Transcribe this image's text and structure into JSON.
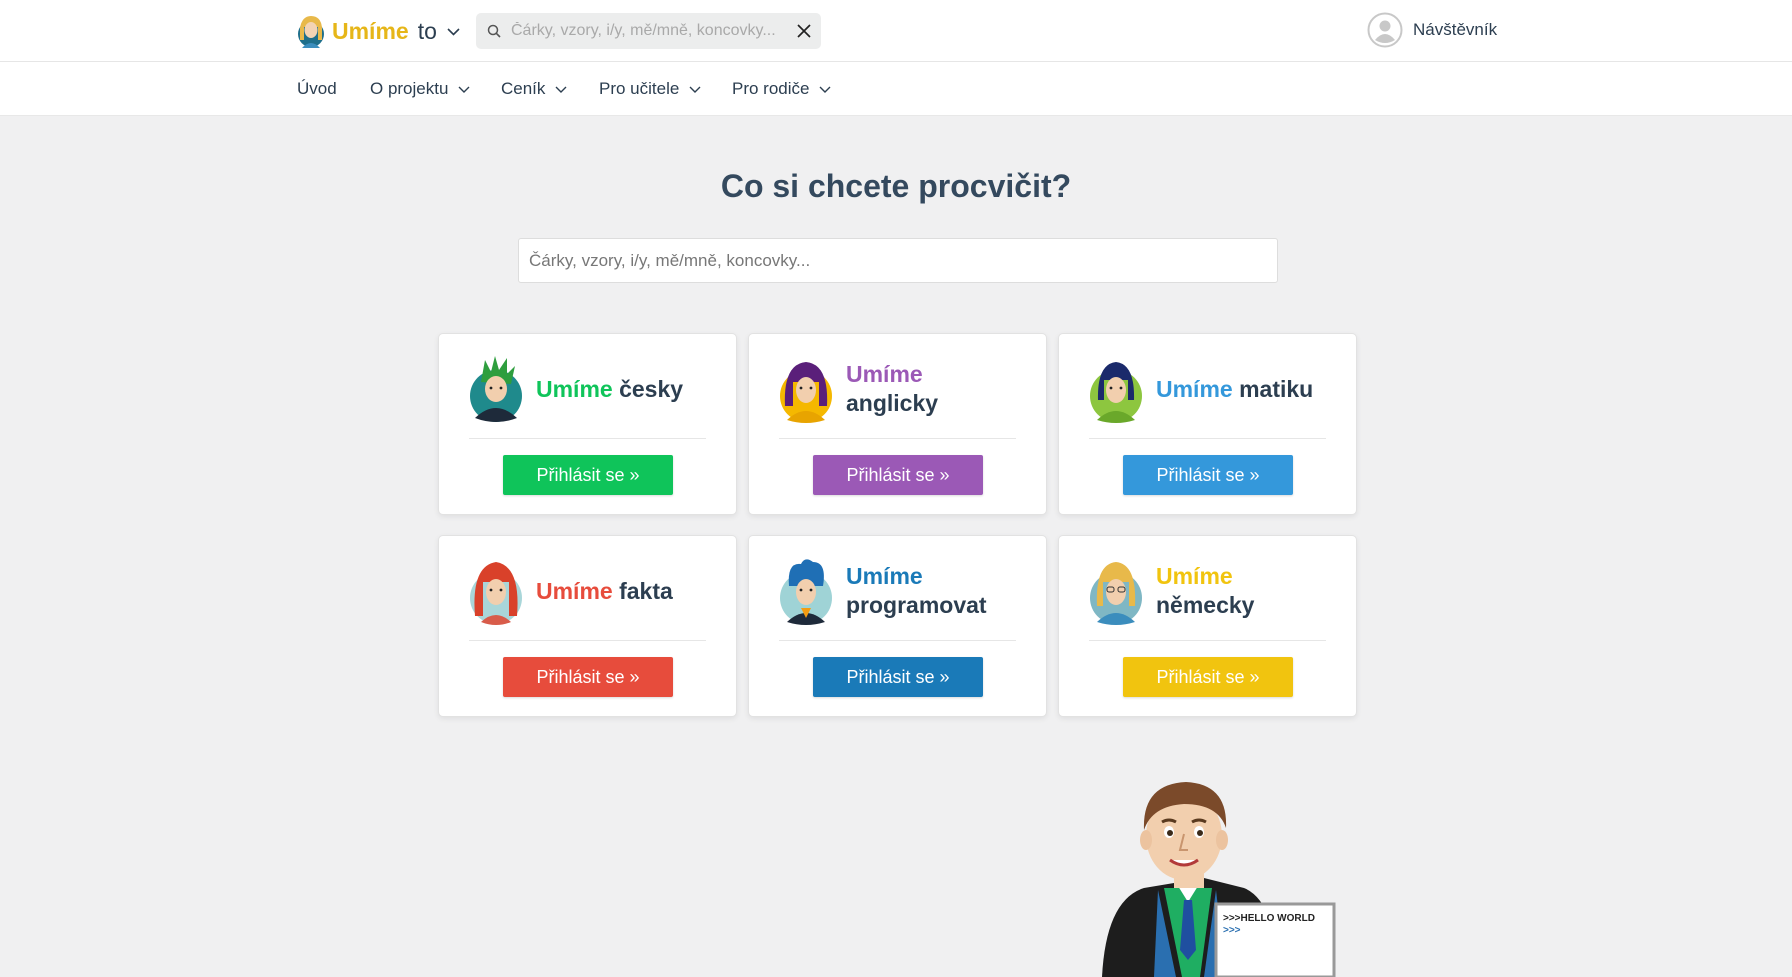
{
  "header": {
    "logo_brand": "Umíme",
    "logo_suffix": "to",
    "search_placeholder": "Čárky, vzory, i/y, mě/mně, koncovky...",
    "user_name": "Návštěvník"
  },
  "nav": {
    "items": [
      {
        "label": "Úvod"
      },
      {
        "label": "O projektu"
      },
      {
        "label": "Ceník"
      },
      {
        "label": "Pro učitele"
      },
      {
        "label": "Pro rodiče"
      }
    ]
  },
  "main": {
    "title": "Co si chcete procvičit?",
    "search_placeholder": "Čárky, vzory, i/y, mě/mně, koncovky..."
  },
  "subjects": [
    {
      "brand": "Umíme",
      "subject": "česky",
      "button": "Přihlásit se  »",
      "color": "#0fc45a"
    },
    {
      "brand": "Umíme",
      "subject": "anglicky",
      "button": "Přihlásit se  »",
      "color": "#9b59b6"
    },
    {
      "brand": "Umíme",
      "subject": "matiku",
      "button": "Přihlásit se  »",
      "color": "#3498db"
    },
    {
      "brand": "Umíme",
      "subject": "fakta",
      "button": "Přihlásit se  »",
      "color": "#e74c3c"
    },
    {
      "brand": "Umíme",
      "subject": "programovat",
      "button": "Přihlásit se  »",
      "color": "#1a7ab8"
    },
    {
      "brand": "Umíme",
      "subject": "německy",
      "button": "Přihlásit se  »",
      "color": "#f1c40f"
    }
  ],
  "mascot": {
    "screen_line1": ">>>HELLO WORLD",
    "screen_line2": ">>>"
  },
  "colors": {
    "logo_brand": "#e6b619",
    "title": "#34495e",
    "background": "#f0f0f1"
  }
}
